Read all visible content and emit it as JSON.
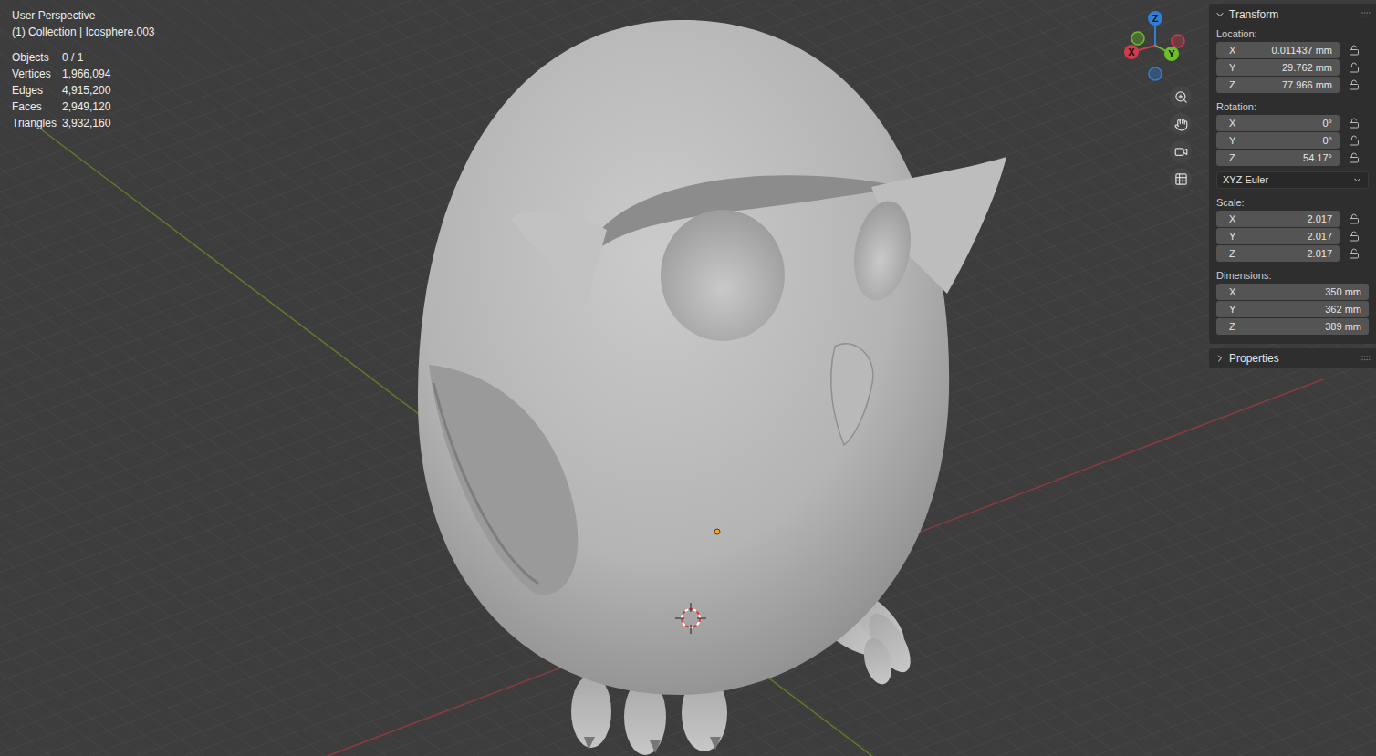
{
  "viewport": {
    "view_name": "User Perspective",
    "collection": "(1) Collection | Icosphere.003"
  },
  "stats": [
    {
      "label": "Objects",
      "value": "0 / 1"
    },
    {
      "label": "Vertices",
      "value": "1,966,094"
    },
    {
      "label": "Edges",
      "value": "4,915,200"
    },
    {
      "label": "Faces",
      "value": "2,949,120"
    },
    {
      "label": "Triangles",
      "value": "3,932,160"
    }
  ],
  "gizmo": {
    "axes": [
      {
        "label": "Z",
        "color": "#2f7fd9"
      },
      {
        "label": "Y",
        "color": "#6bbf2a"
      },
      {
        "label": "X",
        "color": "#d33a4a"
      }
    ]
  },
  "transform": {
    "title": "Transform",
    "expanded": true,
    "sections": [
      {
        "label": "Location:",
        "kind": "locked",
        "fields": [
          {
            "axis": "X",
            "value": "0.011437 mm"
          },
          {
            "axis": "Y",
            "value": "29.762 mm"
          },
          {
            "axis": "Z",
            "value": "77.966 mm"
          }
        ]
      },
      {
        "label": "Rotation:",
        "kind": "locked",
        "fields": [
          {
            "axis": "X",
            "value": "0°"
          },
          {
            "axis": "Y",
            "value": "0°"
          },
          {
            "axis": "Z",
            "value": "54.17°"
          }
        ],
        "mode": "XYZ Euler"
      },
      {
        "label": "Scale:",
        "kind": "locked",
        "fields": [
          {
            "axis": "X",
            "value": "2.017"
          },
          {
            "axis": "Y",
            "value": "2.017"
          },
          {
            "axis": "Z",
            "value": "2.017"
          }
        ]
      },
      {
        "label": "Dimensions:",
        "kind": "plain",
        "fields": [
          {
            "axis": "X",
            "value": "350 mm"
          },
          {
            "axis": "Y",
            "value": "362 mm"
          },
          {
            "axis": "Z",
            "value": "389 mm"
          }
        ]
      }
    ]
  },
  "properties": {
    "title": "Properties",
    "expanded": false
  }
}
